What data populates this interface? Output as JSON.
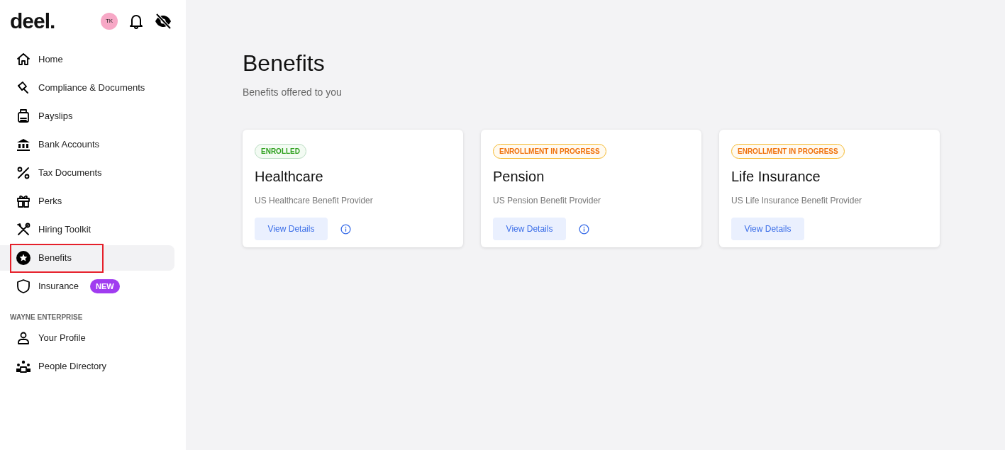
{
  "sidebar": {
    "logo": "deel.",
    "avatar": "TK",
    "items": [
      {
        "label": "Home",
        "selected": false,
        "outlined": false
      },
      {
        "label": "Compliance & Documents",
        "selected": false,
        "outlined": false
      },
      {
        "label": "Payslips",
        "selected": false,
        "outlined": false
      },
      {
        "label": "Bank Accounts",
        "selected": false,
        "outlined": false
      },
      {
        "label": "Tax Documents",
        "selected": false,
        "outlined": false
      },
      {
        "label": "Perks",
        "selected": false,
        "outlined": false
      },
      {
        "label": "Hiring Toolkit",
        "selected": false,
        "outlined": false
      },
      {
        "label": "Benefits",
        "selected": true,
        "outlined": true
      },
      {
        "label": "Insurance",
        "selected": false,
        "outlined": false,
        "badge": "NEW"
      }
    ],
    "section_title": "WAYNE ENTERPRISE",
    "section_items": [
      {
        "label": "Your Profile",
        "selected": false
      },
      {
        "label": "People Directory",
        "selected": false
      }
    ]
  },
  "page": {
    "title": "Benefits",
    "subtitle": "Benefits offered to you",
    "cards": [
      {
        "status": "ENROLLED",
        "kind": "enrolled",
        "title": "Healthcare",
        "provider": "US Healthcare Benefit Provider",
        "button": "View Details",
        "info": true
      },
      {
        "status": "ENROLLMENT IN PROGRESS",
        "kind": "in_progress",
        "title": "Pension",
        "provider": "US Pension Benefit Provider",
        "button": "View Details",
        "info": true
      },
      {
        "status": "ENROLLMENT IN PROGRESS",
        "kind": "in_progress",
        "title": "Life Insurance",
        "provider": "US Life Insurance Benefit Provider",
        "button": "View Details",
        "info": false
      }
    ]
  }
}
